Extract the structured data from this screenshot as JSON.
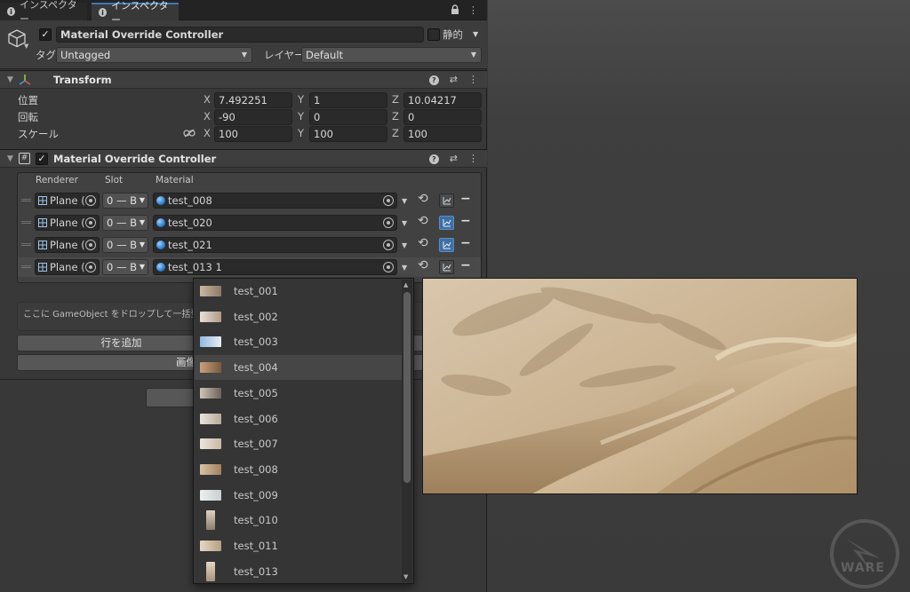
{
  "tabs": [
    {
      "label": "インスペクター"
    },
    {
      "label": "インスペクター"
    }
  ],
  "gameobject": {
    "name": "Material Override Controller",
    "static_label": "静的",
    "tag_label": "タグ",
    "tag_value": "Untagged",
    "layer_label": "レイヤー",
    "layer_value": "Default"
  },
  "transform": {
    "title": "Transform",
    "position_label": "位置",
    "rotation_label": "回転",
    "scale_label": "スケール",
    "position": {
      "x": "7.492251",
      "y": "1",
      "z": "10.04217"
    },
    "rotation": {
      "x": "-90",
      "y": "0",
      "z": "0"
    },
    "scale": {
      "x": "100",
      "y": "100",
      "z": "100"
    },
    "axis": {
      "x": "X",
      "y": "Y",
      "z": "Z"
    }
  },
  "controller": {
    "title": "Material Override Controller",
    "columns": {
      "renderer": "Renderer",
      "slot": "Slot",
      "material": "Material"
    },
    "rows": [
      {
        "renderer": "Plane (",
        "slot": "0 — B",
        "material": "test_008",
        "toggle_on": false
      },
      {
        "renderer": "Plane (",
        "slot": "0 — B",
        "material": "test_020",
        "toggle_on": true
      },
      {
        "renderer": "Plane (",
        "slot": "0 — B",
        "material": "test_021",
        "toggle_on": true
      },
      {
        "renderer": "Plane (",
        "slot": "0 — B",
        "material": "test_013 1",
        "toggle_on": false
      }
    ],
    "drop_hint": "ここに GameObject をドロップして一括登録（子",
    "add_row_label": "行を追加",
    "image_button_label": "画像"
  },
  "popup": {
    "items": [
      {
        "label": "test_001",
        "colors": [
          "#c9b8a2",
          "#8e7a66"
        ],
        "tall": false
      },
      {
        "label": "test_002",
        "colors": [
          "#e8e1d7",
          "#b09a84"
        ],
        "tall": false
      },
      {
        "label": "test_003",
        "colors": [
          "#8fb8e0",
          "#e8eef4"
        ],
        "tall": false
      },
      {
        "label": "test_004",
        "colors": [
          "#c9a27a",
          "#7a5a3e"
        ],
        "tall": false
      },
      {
        "label": "test_005",
        "colors": [
          "#cfc4b8",
          "#6e6258"
        ],
        "tall": false
      },
      {
        "label": "test_006",
        "colors": [
          "#e9e4dd",
          "#b8aa9a"
        ],
        "tall": false
      },
      {
        "label": "test_007",
        "colors": [
          "#ece6de",
          "#c9b8a4"
        ],
        "tall": false
      },
      {
        "label": "test_008",
        "colors": [
          "#d8c2a4",
          "#a0825e"
        ],
        "tall": false
      },
      {
        "label": "test_009",
        "colors": [
          "#eef0f0",
          "#c9cfd2"
        ],
        "tall": false
      },
      {
        "label": "test_010",
        "colors": [
          "#ddd2c4",
          "#8c7d6c"
        ],
        "tall": true
      },
      {
        "label": "test_011",
        "colors": [
          "#e6d8c6",
          "#b79f82"
        ],
        "tall": false
      },
      {
        "label": "test_013",
        "colors": [
          "#e2d6c6",
          "#a8927a"
        ],
        "tall": true
      }
    ],
    "highlighted_index": 3
  },
  "watermark": "WARE"
}
